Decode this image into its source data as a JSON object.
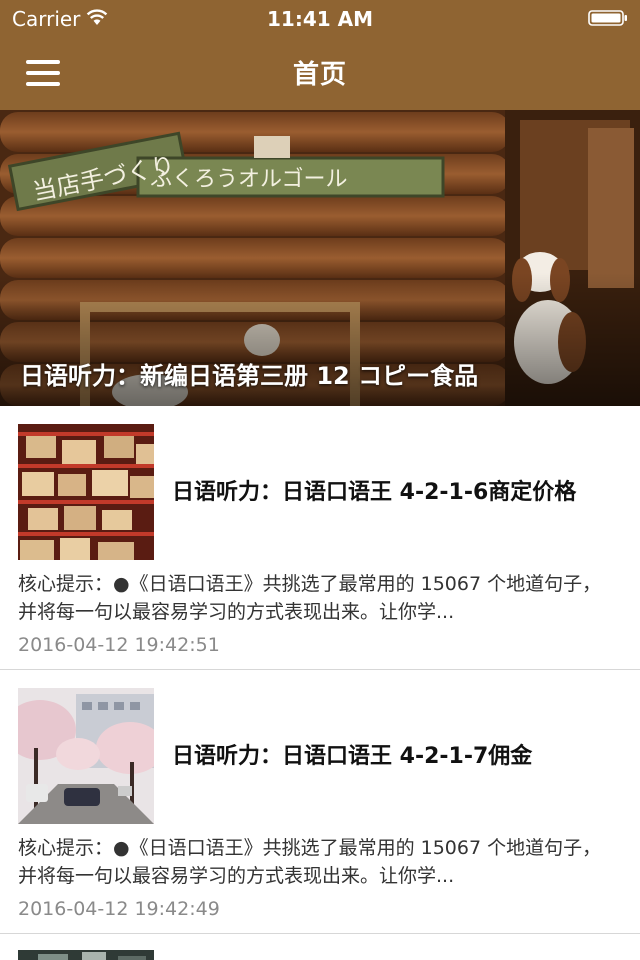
{
  "status_bar": {
    "carrier": "Carrier",
    "time": "11:41 AM"
  },
  "nav_bar": {
    "title": "首页",
    "menu_icon": "hamburger-menu-icon"
  },
  "colors": {
    "nav_background": "#8f6432",
    "date_text": "#8a8a8a"
  },
  "hero": {
    "caption": "日语听力：新编日语第三册 12 コピー食品",
    "sign_top": "当店手づくり",
    "sign_bottom": "ふくろうオルゴール"
  },
  "news": [
    {
      "title": "日语听力：日语口语王 4-2-1-6商定价格",
      "summary": "核心提示：●《日语口语王》共挑选了最常用的 15067 个地道句子，并将每一句以最容易学习的方式表现出来。让你学...",
      "date": "2016-04-12 19:42:51"
    },
    {
      "title": "日语听力：日语口语王 4-2-1-7佣金",
      "summary": "核心提示：●《日语口语王》共挑选了最常用的 15067 个地道句子，并将每一句以最容易学习的方式表现出来。让你学...",
      "date": "2016-04-12 19:42:49"
    }
  ]
}
